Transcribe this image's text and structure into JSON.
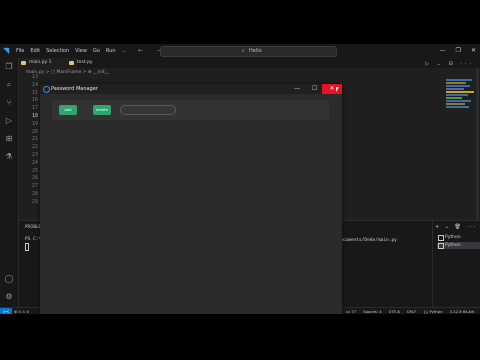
{
  "ide": {
    "menu": [
      "File",
      "Edit",
      "Selection",
      "View",
      "Go",
      "Run",
      "..."
    ],
    "nav_arrows": "← →",
    "search_text": "Hello",
    "window_controls": [
      "—",
      "❐",
      "✕"
    ],
    "tabs": [
      {
        "label": "main.py 1",
        "active": true
      },
      {
        "label": "test.py",
        "active": false
      }
    ],
    "breadcrumb": "main.py > ▢ MainFrame > ⊕ __init__",
    "line_numbers": [
      "13",
      "14",
      "15",
      "16",
      "17",
      "18",
      "19",
      "20",
      "21",
      "22",
      "23",
      "24",
      "25",
      "26",
      "27",
      "28",
      "29"
    ],
    "current_line": "18",
    "editor_icons": "▷ ⌄ ⊟ ···",
    "panel_tab": "PROBLEMS",
    "terminal_prompt": "PS C:\\",
    "terminal_path": "ocuments/Dede/main.py",
    "panel_tools": "+ ⌄ 🗑 ···",
    "terminal_items": [
      {
        "label": "Python",
        "selected": false
      },
      {
        "label": "Python",
        "selected": true
      }
    ],
    "status_left": "⊗ 0 ⚠ 0",
    "status_right": [
      "Ln 77",
      "Spaces: 4",
      "UTF-8",
      "CRLF",
      "{} Python",
      "3.12.6 64-bit"
    ],
    "remote_icon": "><"
  },
  "app": {
    "title": "Password Manager",
    "min": "—",
    "max": "☐",
    "close": "✕",
    "buttons": [
      {
        "label": "add"
      },
      {
        "label": "delete"
      }
    ],
    "entry_value": ""
  }
}
